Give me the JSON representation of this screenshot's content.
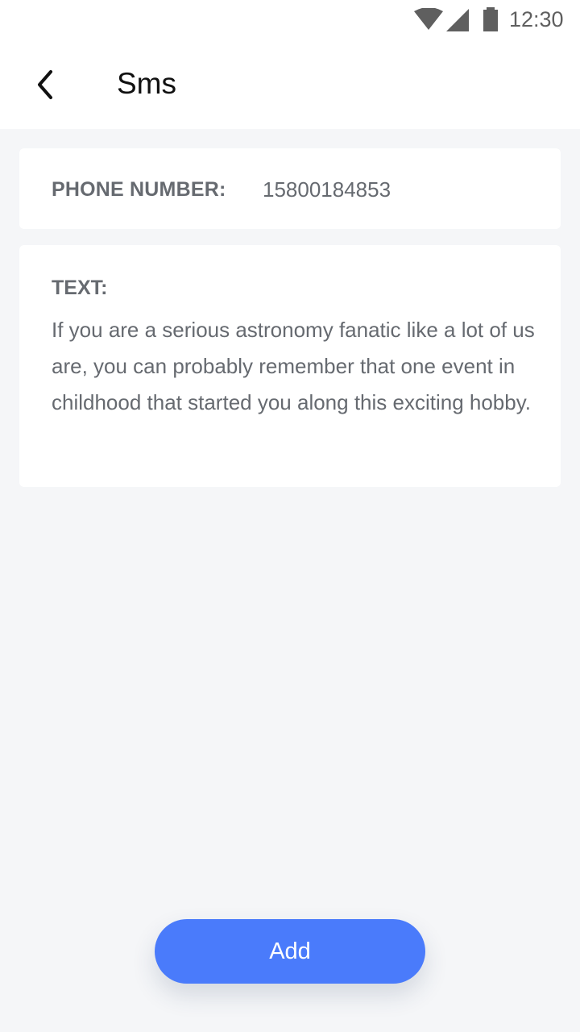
{
  "status_bar": {
    "time": "12:30",
    "icons": [
      "wifi-icon",
      "cell-signal-icon",
      "battery-icon"
    ]
  },
  "header": {
    "back_icon": "chevron-left-icon",
    "title": "Sms"
  },
  "phone": {
    "label": "PHONE NUMBER:",
    "value": "15800184853"
  },
  "message": {
    "label": "TEXT:",
    "body": "If you are a serious astronomy fanatic like a lot of us are, you can probably remember that one event in childhood that started you along this exciting hobby."
  },
  "actions": {
    "add_label": "Add"
  },
  "colors": {
    "accent": "#4a7bfb",
    "background": "#f5f6f8",
    "card": "#ffffff",
    "text_secondary": "#666a70"
  }
}
